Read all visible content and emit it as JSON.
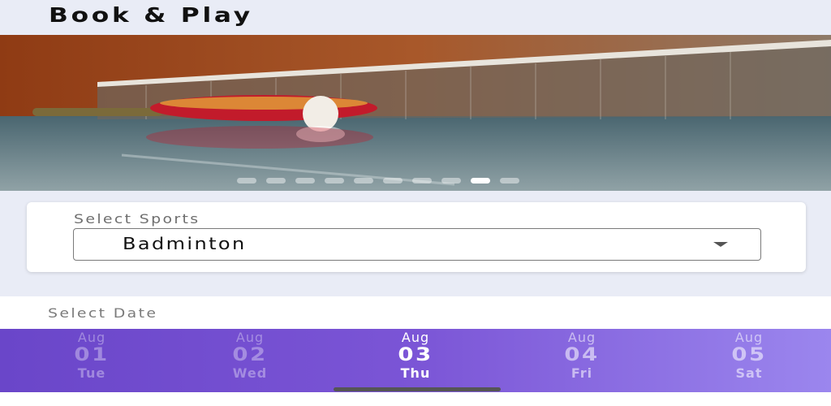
{
  "app": {
    "title": "Book & Play"
  },
  "banner": {
    "slide_count": 10,
    "active_slide": 9
  },
  "sports": {
    "label": "Select Sports",
    "selected": "Badminton"
  },
  "dates": {
    "label": "Select Date",
    "items": [
      {
        "month": "Aug",
        "day": "01",
        "weekday": "Tue"
      },
      {
        "month": "Aug",
        "day": "02",
        "weekday": "Wed"
      },
      {
        "month": "Aug",
        "day": "03",
        "weekday": "Thu"
      },
      {
        "month": "Aug",
        "day": "04",
        "weekday": "Fri"
      },
      {
        "month": "Aug",
        "day": "05",
        "weekday": "Sat"
      }
    ],
    "selected_index": 2
  },
  "colors": {
    "accent_start": "#6a46c9",
    "accent_end": "#9b86ee",
    "background": "#e9ecf6"
  }
}
